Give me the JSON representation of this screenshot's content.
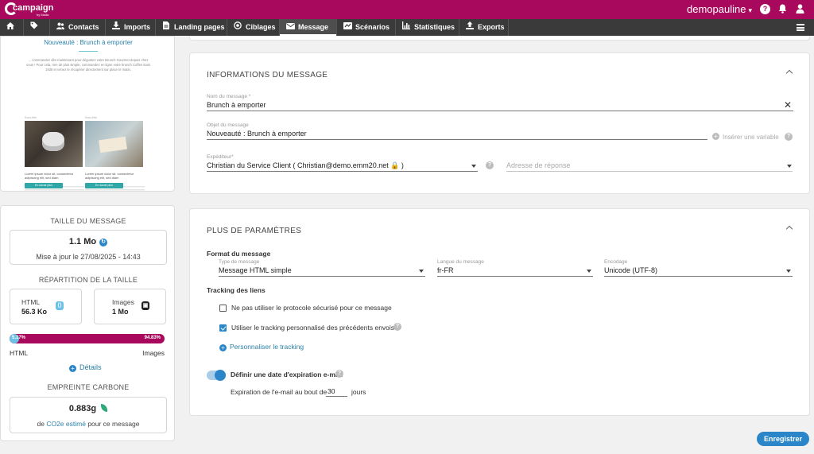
{
  "topbar": {
    "logo_text": "campaign",
    "logo_sub": "by Mailiz",
    "user_name": "demopauline"
  },
  "nav": {
    "items": [
      {
        "label": "",
        "icon": "home-icon"
      },
      {
        "label": "",
        "icon": "tag-icon"
      },
      {
        "label": "Contacts",
        "icon": "contacts-icon"
      },
      {
        "label": "Imports",
        "icon": "import-icon"
      },
      {
        "label": "Landing pages",
        "icon": "page-icon"
      },
      {
        "label": "Ciblages",
        "icon": "target-icon"
      },
      {
        "label": "Message",
        "icon": "envelope-icon",
        "active": true
      },
      {
        "label": "Scénarios",
        "icon": "scenario-icon"
      },
      {
        "label": "Statistiques",
        "icon": "stats-icon"
      },
      {
        "label": "Exports",
        "icon": "export-icon"
      }
    ]
  },
  "preview": {
    "title": "Nouveauté : Brunch à emporter",
    "paragraph": "... commandez dès maintenant pour dégustez votre Brunch Gourmet depuis chez vous ! Pour cela, rien de plus simple, commandez en ligne votre brunch Coffee East 1938 et venez le récupérer directement sur place le matin.",
    "caption1": "Sous-titre",
    "caption2": "Sous-titre",
    "heading1": "Lorem ipsum dolor sit, consectetur adipiscing elit, sed diam",
    "heading2": "Lorem ipsum dolor sit, consectetur adipiscing elit, sed diam",
    "button1": "En savoir plus",
    "button2": "En savoir plus"
  },
  "size": {
    "title": "TAILLE DU MESSAGE",
    "total": "1.1 Mo",
    "updated": "Mise à jour le 27/08/2025 - 14:43",
    "repartition_title": "RÉPARTITION DE LA TAILLE",
    "html_label": "HTML",
    "html_value": "56.3 Ko",
    "images_label": "Images",
    "images_value": "1 Mo",
    "html_percent": 5.17,
    "html_percent_label": "5.17%",
    "images_percent_label": "94.83%",
    "legend_left": "HTML",
    "legend_right": "Images",
    "details_label": "Détails"
  },
  "carbon": {
    "title": "EMPREINTE CARBONE",
    "value": "0.883g",
    "prefix": "de",
    "link": "CO2e estimé",
    "suffix": "pour ce message"
  },
  "message_info": {
    "title": "INFORMATIONS DU MESSAGE",
    "name_label": "Nom du message *",
    "name_value": "Brunch à emporter",
    "subject_label": "Objet du message",
    "subject_value": "Nouveauté : Brunch à emporter",
    "insert_variable": "Insérer une variable",
    "sender_label": "Expéditeur*",
    "sender_value": "Christian du Service Client ( Christian@demo.emm20.net 🔒 )",
    "reply_placeholder": "Adresse de réponse"
  },
  "params": {
    "title": "PLUS DE PARAMÈTRES",
    "format_title": "Format du message",
    "type_label": "Type de message",
    "type_value": "Message HTML simple",
    "lang_label": "Langue du message",
    "lang_value": "fr-FR",
    "encoding_label": "Encodage",
    "encoding_value": "Unicode (UTF-8)",
    "tracking_title": "Tracking des liens",
    "check1_label": "Ne pas utiliser le protocole sécurisé pour ce message",
    "check1_checked": false,
    "check2_label": "Utiliser le tracking personnalisé des précédents envois",
    "check2_checked": true,
    "personalize_label": "Personnaliser le tracking",
    "expiry_toggle_label": "Définir une date d'expiration e-mail",
    "expiry_prefix": "Expiration de l'e-mail au bout de",
    "expiry_days": "30",
    "expiry_suffix": "jours"
  },
  "save_label": "Enregistrer"
}
